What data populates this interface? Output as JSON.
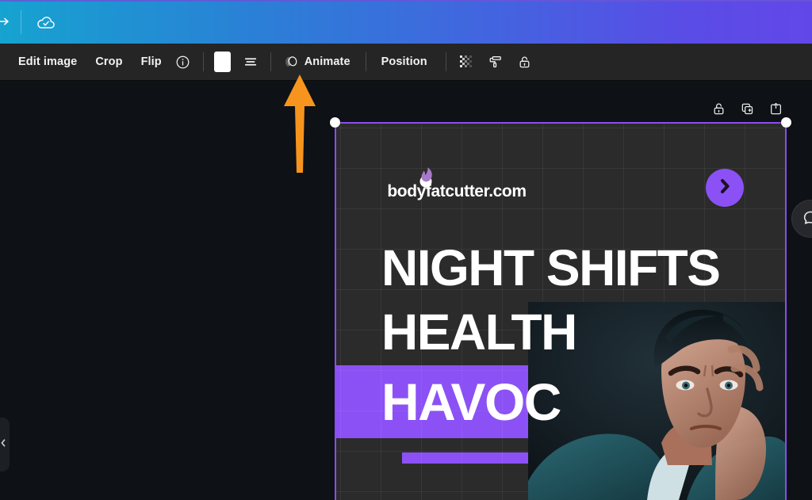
{
  "topbar": {
    "redo_icon": "redo-arrow-icon",
    "save_status_icon": "cloud-saved-icon",
    "gradient_from": "#16a3d0",
    "gradient_to": "#6247e8"
  },
  "toolbar": {
    "edit_image_label": "Edit image",
    "crop_label": "Crop",
    "flip_label": "Flip",
    "info_icon": "info-circle-icon",
    "color_swatch_value": "#ffffff",
    "align_icon": "align-lines-icon",
    "animate_label": "Animate",
    "animate_icon": "animate-icon",
    "position_label": "Position",
    "transparency_icon": "transparency-checker-icon",
    "paint_roller_icon": "paint-roller-icon",
    "lock_icon": "lock-open-icon"
  },
  "canvas": {
    "left_panel_toggle_icon": "chevron-left-icon",
    "comment_icon": "comment-bubble-icon",
    "card_actions": [
      {
        "name": "lock-element",
        "icon": "lock-open-icon"
      },
      {
        "name": "duplicate-element",
        "icon": "duplicate-icon"
      },
      {
        "name": "add-to-page",
        "icon": "add-to-page-icon"
      }
    ],
    "selection_color": "#8b4df0",
    "background": "#2b2b2b"
  },
  "design": {
    "logo_text": "bodyfatcutter.com",
    "logo_mark_icon": "flame-mark-icon",
    "headline_lines": [
      "NIGHT SHIFTS",
      "HEALTH"
    ],
    "highlight_line": "HAVOC",
    "accent_color": "#8b51f5",
    "arrow_button_icon": "chevron-right-icon",
    "photo_alt": "stressed-man-photo"
  },
  "annotation": {
    "arrow_color": "#f7941d",
    "points_to": "Animate"
  }
}
